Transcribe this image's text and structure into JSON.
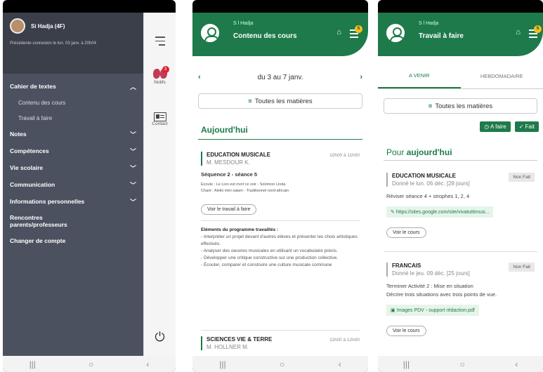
{
  "p1": {
    "user_name": "Si        Hadja (4F)",
    "last_conn": "Précédente connexion le lun. 03 janv. à 20h04",
    "menu": [
      {
        "label": "Cahier de textes",
        "chevron": "︿"
      },
      {
        "label": "Notes",
        "chevron": "﹀"
      },
      {
        "label": "Compétences",
        "chevron": "﹀"
      },
      {
        "label": "Vie scolaire",
        "chevron": "﹀"
      },
      {
        "label": "Communication",
        "chevron": "﹀"
      },
      {
        "label": "Informations personnelles",
        "chevron": "﹀"
      },
      {
        "label": "Rencontres parents/professeurs"
      },
      {
        "label": "Changer de compte"
      }
    ],
    "sub": [
      "Contenu des cours",
      "Travail à faire"
    ],
    "rail": {
      "notifs": "Notifs",
      "notifs_count": "3",
      "contact": "Contact"
    }
  },
  "p2": {
    "user": "S        l Hadja",
    "title": "Contenu des cours",
    "week": "du 3 au 7 janv.",
    "all": "Toutes les matières",
    "today": "Aujourd'hui",
    "badge": "5",
    "c1": {
      "subject": "EDUCATION MUSICALE",
      "time": "10h00 à 11h00",
      "prof": "M. MESDOUR K.",
      "seq": "Séquence 2 - séance 5",
      "line1": "Ecoute : Le Lion est mort ce soir - Solomon Linda",
      "line2": "Chant : Aleiki mini salam - Traditionnel nord-africain",
      "btn": "Voir le travail à faire",
      "elem_title": "Eléments du programme travaillés :",
      "elems": [
        "- Interpréter un projet devant d'autres élèves et présenter les choix artistiques effectués.",
        "- Analyser des oeuvres musicales en utilisant un vocabulaire précis.",
        "- Développer une critique constructive sur une production collective.",
        "- Écouter, comparer et construire une culture musicale commune"
      ]
    },
    "c2": {
      "subject": "SCIENCES VIE & TERRE",
      "time": "11h00 à 12h00",
      "prof": "M. HOLLNER M."
    }
  },
  "p3": {
    "user": "S        l Hadja",
    "title": "Travail à faire",
    "badge": "5",
    "tabs": [
      "A VENIR",
      "HEBDOMADAIRE"
    ],
    "all": "Toutes les matières",
    "afaire": "A faire",
    "fait": "Fait",
    "pour": "Pour ",
    "today": "aujourd'hui",
    "c1": {
      "subject": "EDUCATION MUSICALE",
      "given": "Donné le lun. 06 déc. [28 jours]",
      "status": "Non Fait",
      "task": "Réviser séance 4 + strophes 1, 2, 4",
      "link": "https://sites.google.com/site/vivatuttimusi...",
      "btn": "Voir le cours"
    },
    "c2": {
      "subject": "FRANCAIS",
      "given": "Donné le jeu. 09 déc. [25 jours]",
      "status": "Non Fait",
      "task1": "Terminer Activité 2 : Mise en situation",
      "task2": "Décrire trois situations avec trois points de vue.",
      "link": "Images PDV - support rédaction.pdf",
      "btn": "Voir le cours"
    }
  },
  "nav": [
    "|||",
    "○",
    "‹"
  ]
}
